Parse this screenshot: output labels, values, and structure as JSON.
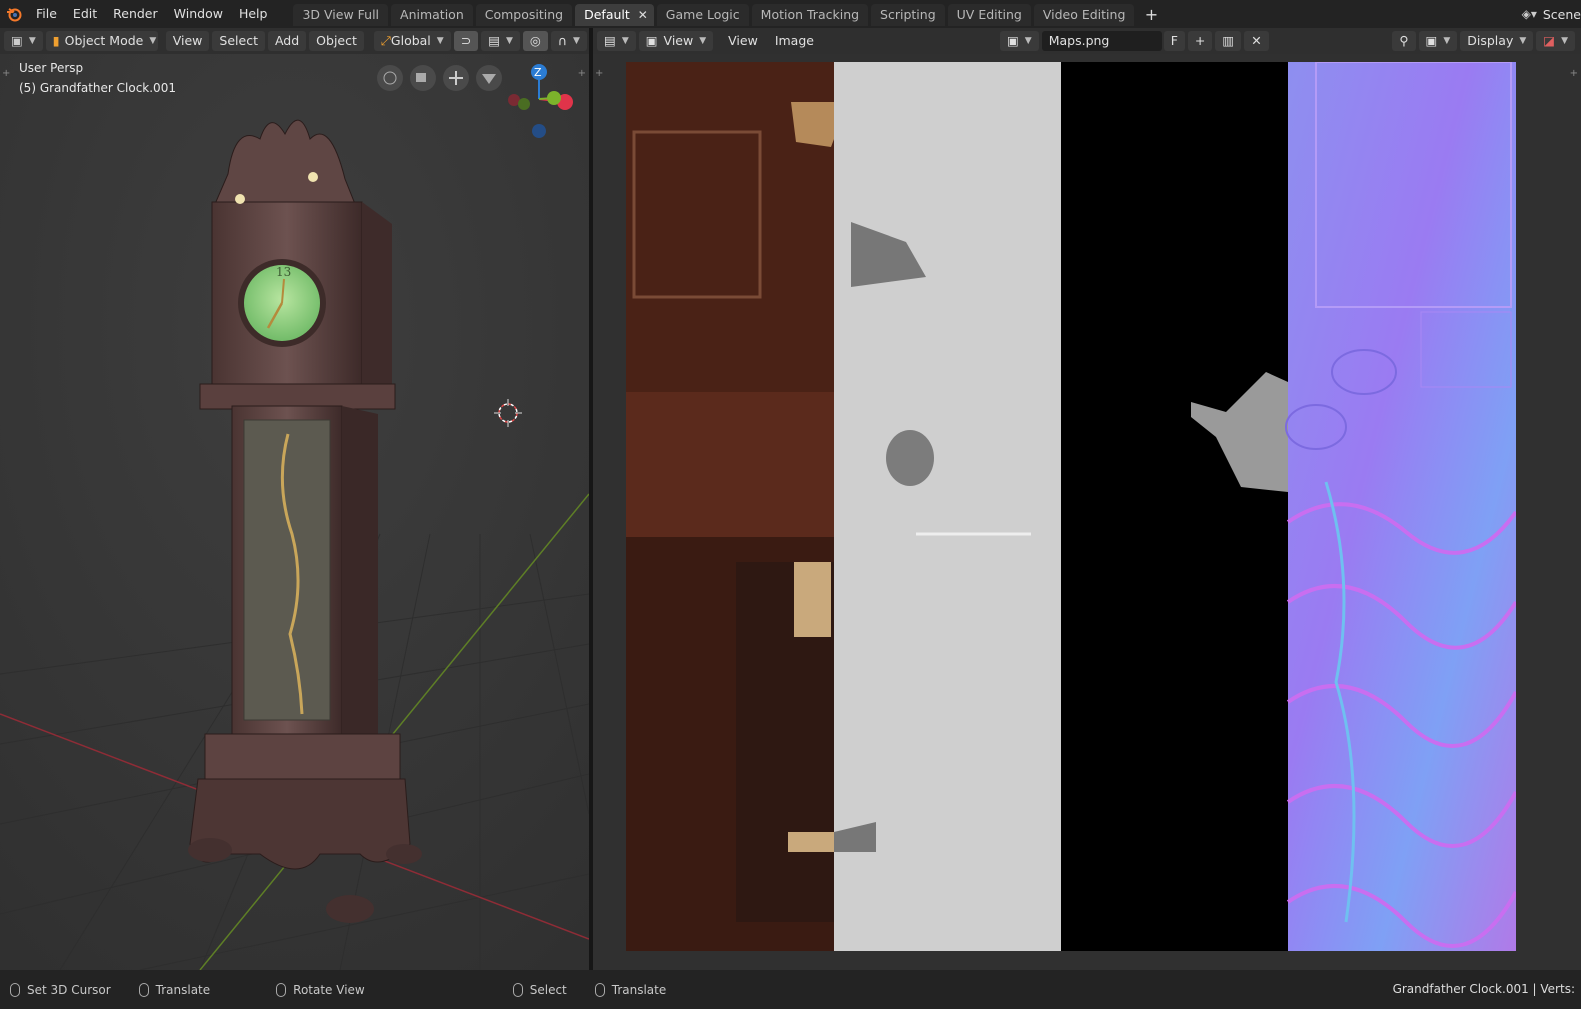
{
  "topbar": {
    "menus": [
      "File",
      "Edit",
      "Render",
      "Window",
      "Help"
    ],
    "workspace_tabs": [
      "3D View Full",
      "Animation",
      "Compositing",
      "Default",
      "Game Logic",
      "Motion Tracking",
      "Scripting",
      "UV Editing",
      "Video Editing"
    ],
    "active_tab": "Default",
    "scene_label": "Scene"
  },
  "viewport_header": {
    "mode": "Object Mode",
    "menus": [
      "View",
      "Select",
      "Add",
      "Object"
    ],
    "orientation": "Global"
  },
  "image_header": {
    "view_dropdown": "View",
    "menus": [
      "View",
      "Image"
    ],
    "image_name": "Maps.png",
    "fake_user": "F",
    "display": "Display"
  },
  "viewport": {
    "view_name": "User Persp",
    "object_name": "(5) Grandfather Clock.001",
    "gizmo_axes": {
      "z": "Z"
    },
    "clock_numeral": "13"
  },
  "statusbar": {
    "items": [
      "Set 3D Cursor",
      "Translate",
      "Rotate View",
      "Select",
      "Translate"
    ],
    "right_text": "Grandfather Clock.001 | Verts:"
  },
  "colors": {
    "accent": "#4772b3",
    "axis_z": "#2b7cd3",
    "axis_x": "#e0344a",
    "axis_y": "#7cb32b",
    "normal_map": "#8a8cf0"
  }
}
